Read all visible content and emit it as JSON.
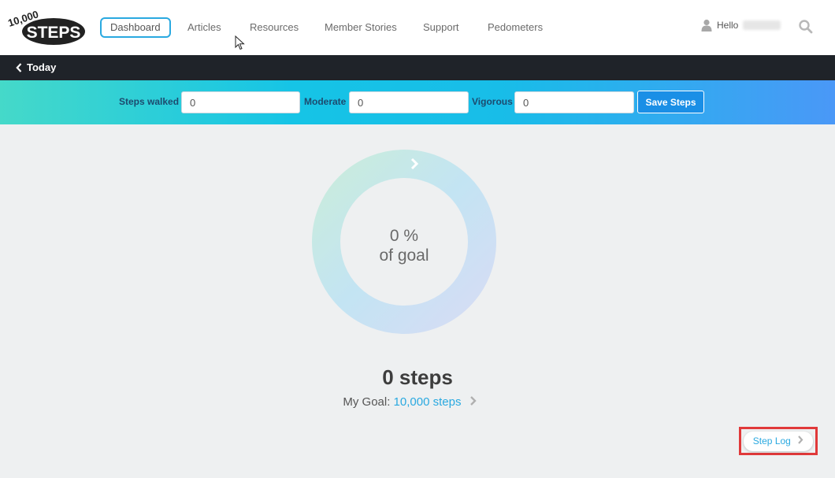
{
  "brand": {
    "logo_text_top": "10,000",
    "logo_text_main": "STEPS"
  },
  "nav": {
    "items": [
      "Dashboard",
      "Articles",
      "Resources",
      "Member Stories",
      "Support",
      "Pedometers"
    ],
    "active": "Dashboard",
    "greeting": "Hello"
  },
  "today_label": "Today",
  "entry": {
    "steps_label": "Steps walked",
    "steps_value": "0",
    "moderate_label": "Moderate",
    "moderate_value": "0",
    "vigorous_label": "Vigorous",
    "vigorous_value": "0",
    "save_label": "Save Steps"
  },
  "progress": {
    "percent_text": "0 %",
    "of_goal": "of goal",
    "fraction": 0
  },
  "summary": {
    "steps_text": "0 steps",
    "goal_prefix": "My Goal:",
    "goal_value": "10,000 steps"
  },
  "step_log_label": "Step Log",
  "colors": {
    "accent": "#2aa9e0",
    "save_button": "#1a8fe6",
    "dark_bar": "#1f2329",
    "highlight": "#e0393a"
  }
}
